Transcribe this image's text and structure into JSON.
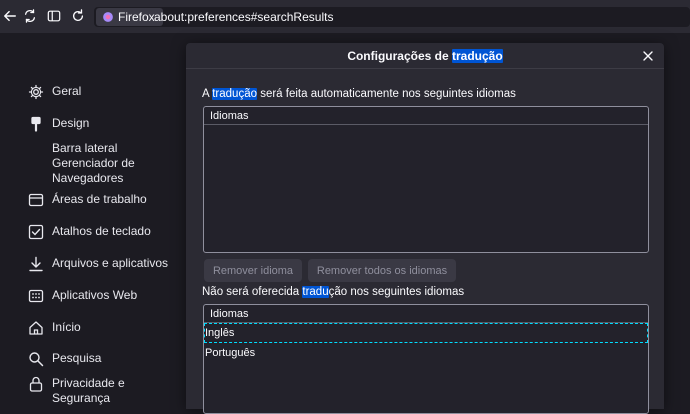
{
  "browser": {
    "identity_label": "Firefox",
    "url": "about:preferences#searchResults"
  },
  "sidebar": {
    "items": [
      {
        "name": "geral",
        "label": "Geral",
        "icon": "gear-icon"
      },
      {
        "name": "design",
        "label": "Design",
        "icon": "paintbrush-icon"
      },
      {
        "name": "barra-lateral",
        "label": "Barra lateral\nGerenciador de\nNavegadores",
        "icon": "none"
      },
      {
        "name": "areas",
        "label": "Áreas de trabalho",
        "icon": "window-icon"
      },
      {
        "name": "atalhos",
        "label": "Atalhos de teclado",
        "icon": "checkbox-icon"
      },
      {
        "name": "arquivos",
        "label": "Arquivos e aplicativos",
        "icon": "download-icon"
      },
      {
        "name": "webapps",
        "label": "Aplicativos Web",
        "icon": "grid-icon"
      },
      {
        "name": "inicio",
        "label": "Início",
        "icon": "home-icon"
      },
      {
        "name": "pesquisa",
        "label": "Pesquisa",
        "icon": "search-icon"
      },
      {
        "name": "privacidade",
        "label": "Privacidade e\nSegurança",
        "icon": "lock-icon"
      }
    ]
  },
  "dialog": {
    "title_before": "Configurações de ",
    "title_highlight": "tradução",
    "section1": {
      "label_before": "A ",
      "label_highlight": "tradução",
      "label_after": " será feita automaticamente nos seguintes idiomas",
      "column_header": "Idiomas",
      "rows": []
    },
    "remove_button": "Remover idioma",
    "remove_all_button": "Remover todos os idiomas",
    "section2": {
      "label_before": "Não será oferecida ",
      "label_highlight": "tradu",
      "label_after": "ção nos seguintes idiomas",
      "column_header": "Idiomas",
      "rows": [
        "Inglês",
        "Português"
      ]
    }
  }
}
